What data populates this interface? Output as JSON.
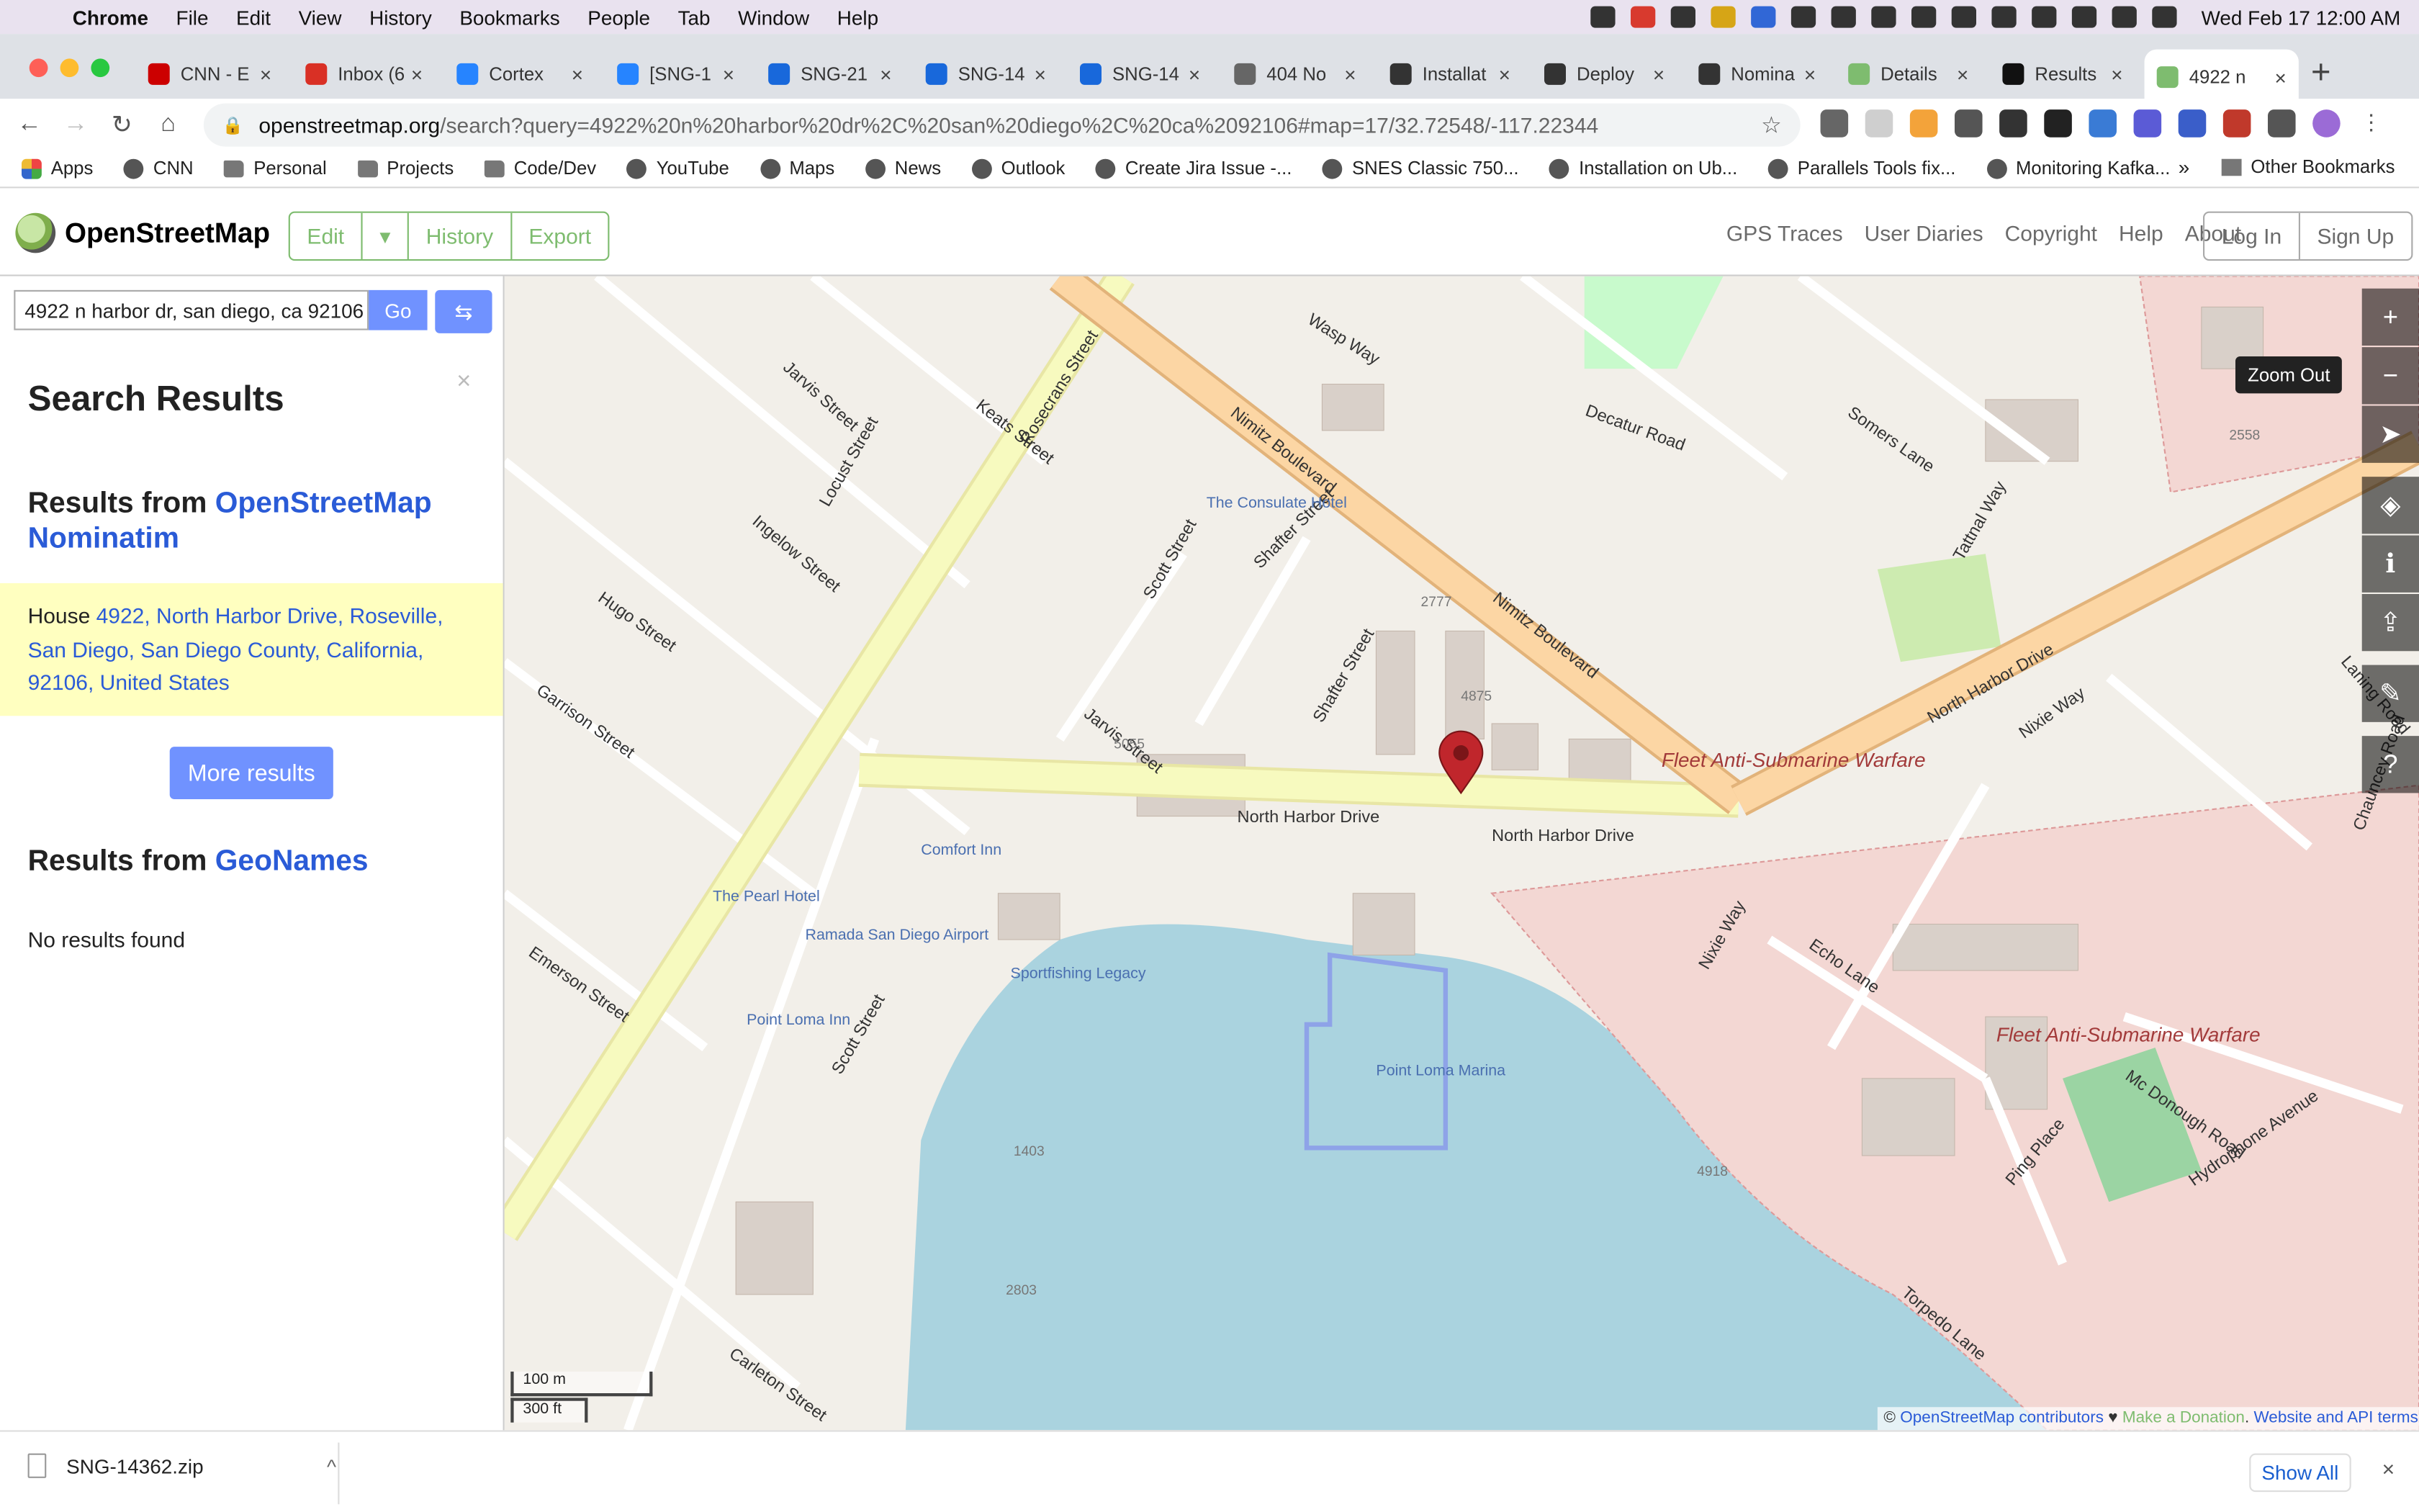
{
  "menubar": {
    "app": "Chrome",
    "items": [
      "File",
      "Edit",
      "View",
      "History",
      "Bookmarks",
      "People",
      "Tab",
      "Window",
      "Help"
    ],
    "clock": "Wed Feb 17  12:00 AM"
  },
  "tabs": [
    {
      "label": "CNN - E",
      "icon": "cnn-favicon",
      "color": "#cc0000"
    },
    {
      "label": "Inbox (6",
      "icon": "gmail-favicon",
      "color": "#d93025"
    },
    {
      "label": "Cortex",
      "icon": "jira-favicon",
      "color": "#2684ff"
    },
    {
      "label": "[SNG-1",
      "icon": "jira-favicon",
      "color": "#2684ff"
    },
    {
      "label": "SNG-21",
      "icon": "confluence-favicon",
      "color": "#1868db"
    },
    {
      "label": "SNG-14",
      "icon": "confluence-favicon",
      "color": "#1868db"
    },
    {
      "label": "SNG-14",
      "icon": "confluence-favicon",
      "color": "#1868db"
    },
    {
      "label": "404 No",
      "icon": "globe-favicon",
      "color": "#666666"
    },
    {
      "label": "Installat",
      "icon": "book-favicon",
      "color": "#333333"
    },
    {
      "label": "Deploy",
      "icon": "book-favicon",
      "color": "#333333"
    },
    {
      "label": "Nomina",
      "icon": "book-favicon",
      "color": "#333333"
    },
    {
      "label": "Details",
      "icon": "osm-favicon",
      "color": "#7ebc6f"
    },
    {
      "label": "Results",
      "icon": "github-favicon",
      "color": "#111111"
    },
    {
      "label": "4922 n",
      "icon": "osm-favicon",
      "color": "#7ebc6f"
    }
  ],
  "address": {
    "host": "openstreetmap.org",
    "path": "/search?query=4922%20n%20harbor%20dr%2C%20san%20diego%2C%20ca%2092106#map=17/32.72548/-117.22344"
  },
  "bookmarks": [
    {
      "label": "Apps",
      "icon": "grid"
    },
    {
      "label": "CNN",
      "icon": "globe"
    },
    {
      "label": "Personal",
      "icon": "folder"
    },
    {
      "label": "Projects",
      "icon": "folder"
    },
    {
      "label": "Code/Dev",
      "icon": "folder"
    },
    {
      "label": "YouTube",
      "icon": "globe"
    },
    {
      "label": "Maps",
      "icon": "globe"
    },
    {
      "label": "News",
      "icon": "globe"
    },
    {
      "label": "Outlook",
      "icon": "globe"
    },
    {
      "label": "Create Jira Issue -...",
      "icon": "globe"
    },
    {
      "label": "SNES Classic 750...",
      "icon": "globe"
    },
    {
      "label": "Installation on Ub...",
      "icon": "globe"
    },
    {
      "label": "Parallels Tools fix...",
      "icon": "globe"
    },
    {
      "label": "Monitoring Kafka...",
      "icon": "globe"
    }
  ],
  "bookmarks_more": "»",
  "other_bookmarks": "Other Bookmarks",
  "osm": {
    "site_name": "OpenStreetMap",
    "edit": "Edit",
    "history": "History",
    "export": "Export",
    "links": [
      "GPS Traces",
      "User Diaries",
      "Copyright",
      "Help",
      "About"
    ],
    "login": "Log In",
    "signup": "Sign Up"
  },
  "sidebar": {
    "search_value": "4922 n harbor dr, san diego, ca 92106",
    "go": "Go",
    "title": "Search Results",
    "close": "×",
    "results_from": "Results from",
    "nominatim_link": "OpenStreetMap Nominatim",
    "result_prefix": "House",
    "result_link": "4922, North Harbor Drive, Roseville, San Diego, San Diego County, California, 92106, United States",
    "more_results": "More results",
    "geonames_link": "GeoNames",
    "no_results": "No results found"
  },
  "map": {
    "tooltip": "Zoom Out",
    "controls": [
      "zoom-in",
      "zoom-out",
      "locate",
      "layers",
      "legend",
      "share",
      "note",
      "query"
    ],
    "scale_metric": "100 m",
    "scale_imperial": "300 ft",
    "attribution_prefix": "©",
    "attribution_link": "OpenStreetMap contributors",
    "attribution_heart": "♥",
    "donation": "Make a Donation",
    "terms": "Website and API terms",
    "labels": [
      {
        "text": "North Harbor Drive",
        "kind": "road"
      },
      {
        "text": "North Harbor Drive",
        "kind": "road"
      },
      {
        "text": "North Harbor Drive",
        "kind": "road"
      },
      {
        "text": "Nimitz Boulevard",
        "kind": "road"
      },
      {
        "text": "Nimitz Boulevard",
        "kind": "road"
      },
      {
        "text": "Rosecrans Street",
        "kind": "road"
      },
      {
        "text": "Scott Street",
        "kind": "road"
      },
      {
        "text": "Scott Street",
        "kind": "road"
      },
      {
        "text": "Shafter Street",
        "kind": "road"
      },
      {
        "text": "Shafter Street",
        "kind": "road"
      },
      {
        "text": "Jarvis Street",
        "kind": "road"
      },
      {
        "text": "Jarvis Street",
        "kind": "road"
      },
      {
        "text": "Keats Street",
        "kind": "road"
      },
      {
        "text": "Locust Street",
        "kind": "road"
      },
      {
        "text": "Ingelow Street",
        "kind": "road"
      },
      {
        "text": "Hugo Street",
        "kind": "road"
      },
      {
        "text": "Garrison Street",
        "kind": "road"
      },
      {
        "text": "Emerson Street",
        "kind": "road"
      },
      {
        "text": "Carleton Street",
        "kind": "road"
      },
      {
        "text": "Decatur Road",
        "kind": "road"
      },
      {
        "text": "Somers Lane",
        "kind": "road"
      },
      {
        "text": "Tattnal Way",
        "kind": "road"
      },
      {
        "text": "Nixie Way",
        "kind": "road"
      },
      {
        "text": "Nixie Way",
        "kind": "road"
      },
      {
        "text": "Echo Lane",
        "kind": "road"
      },
      {
        "text": "Laning Road",
        "kind": "road"
      },
      {
        "text": "Chauncey Road",
        "kind": "road"
      },
      {
        "text": "Mc Donough Road",
        "kind": "road"
      },
      {
        "text": "Hydrophone Avenue",
        "kind": "road"
      },
      {
        "text": "Ping Place",
        "kind": "road"
      },
      {
        "text": "Torpedo Lane",
        "kind": "road"
      },
      {
        "text": "Wasp Way",
        "kind": "road"
      },
      {
        "text": "The Consulate Hotel",
        "kind": "poi"
      },
      {
        "text": "The Pearl Hotel",
        "kind": "poi"
      },
      {
        "text": "Ramada San Diego Airport",
        "kind": "poi"
      },
      {
        "text": "Comfort Inn",
        "kind": "poi"
      },
      {
        "text": "Point Loma Inn",
        "kind": "poi"
      },
      {
        "text": "Point Loma Marina",
        "kind": "poi"
      },
      {
        "text": "Sportfishing Legacy",
        "kind": "poi"
      },
      {
        "text": "Fleet Anti-Submarine Warfare",
        "kind": "military"
      },
      {
        "text": "Fleet Anti-Submarine Warfare",
        "kind": "military"
      },
      {
        "text": "4875",
        "kind": "house"
      },
      {
        "text": "4918",
        "kind": "house"
      },
      {
        "text": "2558",
        "kind": "house"
      },
      {
        "text": "5055",
        "kind": "house"
      },
      {
        "text": "1403",
        "kind": "house"
      },
      {
        "text": "2803",
        "kind": "house"
      },
      {
        "text": "2777",
        "kind": "house"
      }
    ]
  },
  "download": {
    "file": "SNG-14362.zip",
    "show_all": "Show All",
    "close": "×"
  },
  "colors": {
    "osm_green": "#7ebc6f",
    "osm_blue": "#7092ff",
    "link": "#2a5bd7",
    "result_bg": "#ffffc0",
    "water": "#aad3df",
    "primary_road": "#fcd6a4",
    "secondary_road": "#f7fabf",
    "military": "#f3d7d3",
    "marker": "#c0262c"
  }
}
